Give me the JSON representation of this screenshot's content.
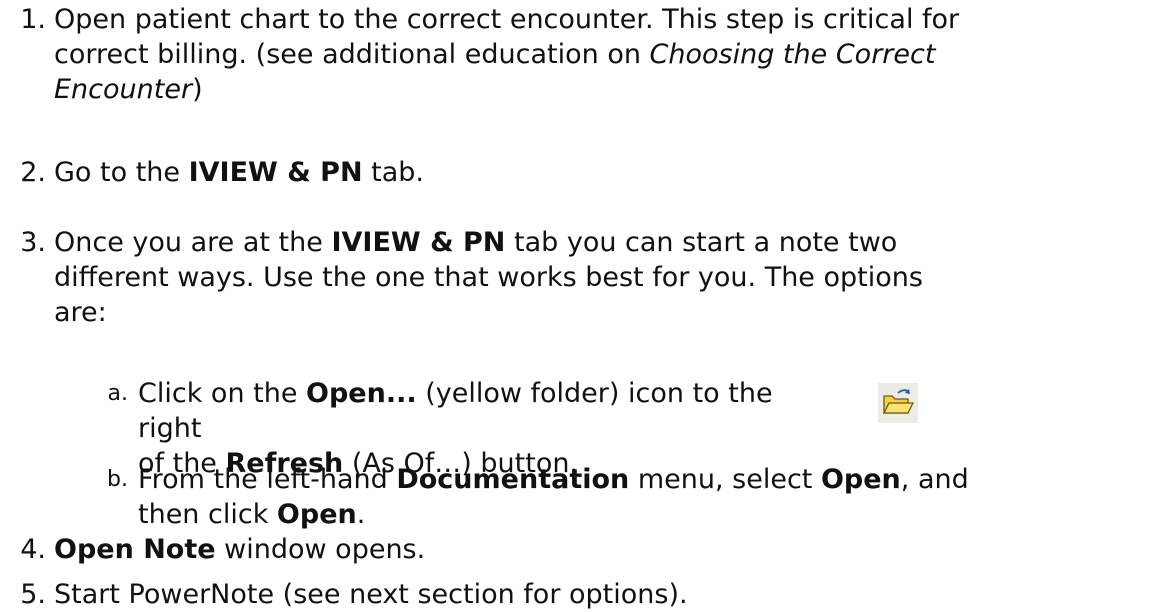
{
  "steps": [
    {
      "number": "1.",
      "lines": [
        "Open patient chart to the correct encounter. This step is critical for",
        "correct billing. (see additional education on ",
        "Choosing the Correct",
        "Encounter",
        ")"
      ]
    },
    {
      "number": "2.",
      "parts": [
        "Go to the ",
        "IVIEW & PN",
        " tab."
      ]
    },
    {
      "number": "3.",
      "parts": [
        "Once you are at the ",
        "IVIEW & PN",
        " tab you can start a note two",
        "different ways.  Use the one that works best for you.  The options",
        "are:"
      ]
    },
    {
      "number": "4.",
      "parts": [
        "Open Note",
        " window opens."
      ]
    },
    {
      "number": "5.",
      "parts": [
        "Start PowerNote (see next section for options)."
      ]
    }
  ],
  "substeps": [
    {
      "letter": "a.",
      "parts": [
        "Click on the ",
        "Open...",
        " (yellow folder) icon  to the right",
        "of the ",
        "Refresh",
        " (As Of…) button."
      ]
    },
    {
      "letter": "b.",
      "parts": [
        "From the left-hand ",
        "Documentation",
        " menu, select ",
        "Open",
        ", and",
        "then click ",
        "Open",
        "."
      ]
    }
  ],
  "icon": {
    "name": "open-folder-icon",
    "color": "#f2d23a"
  }
}
